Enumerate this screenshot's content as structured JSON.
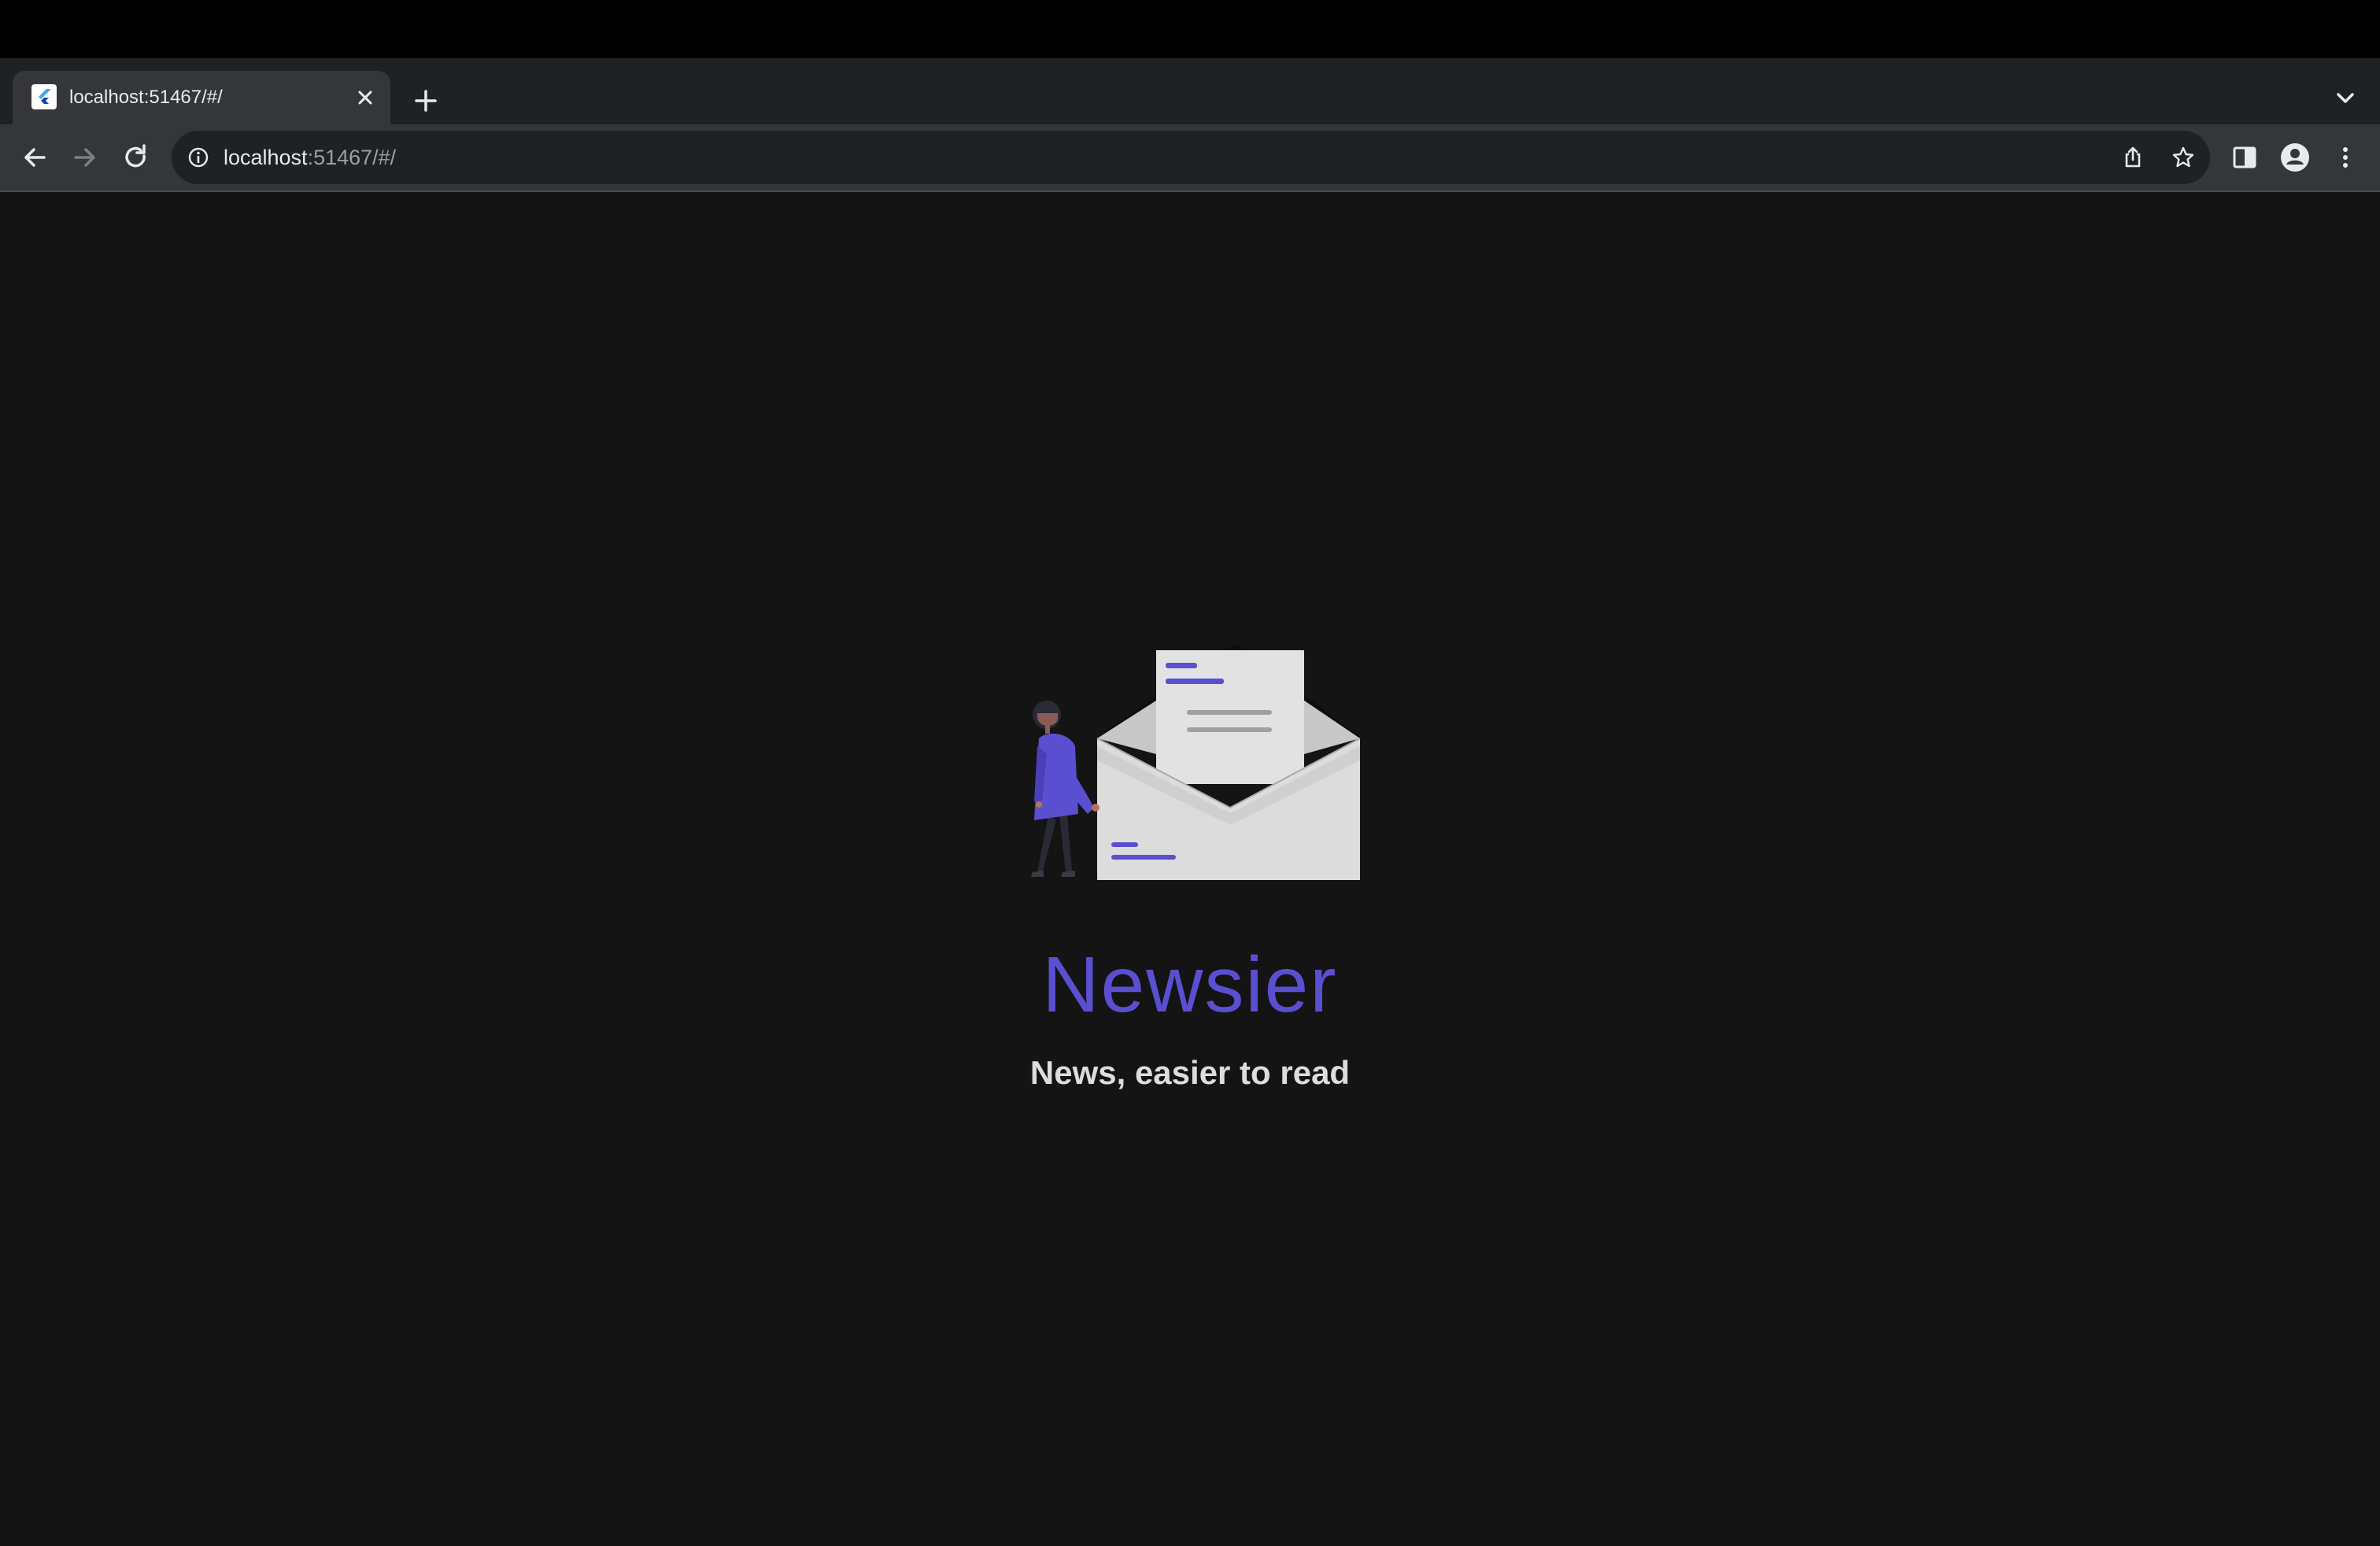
{
  "browser": {
    "tab": {
      "title": "localhost:51467/#/",
      "favicon": "flutter-icon"
    },
    "address_bar": {
      "host": "localhost",
      "path": ":51467/#/"
    },
    "icons": {
      "back": "arrow-left-icon",
      "forward": "arrow-right-icon",
      "reload": "reload-icon",
      "site_info": "info-icon",
      "share": "share-icon",
      "bookmark": "star-icon",
      "side_panel": "side-panel-icon",
      "profile": "profile-icon",
      "menu": "kebab-menu-icon",
      "new_tab": "plus-icon",
      "tab_list": "chevron-down-icon",
      "tab_close": "close-icon"
    }
  },
  "app": {
    "title": "Newsier",
    "subtitle": "News, easier to read",
    "illustration": "person-with-open-envelope-illustration"
  },
  "colors": {
    "background": "#141414",
    "accent": "#5b4fd1",
    "subtitle": "#dddddd",
    "tab_strip": "#202124",
    "toolbar": "#35363a"
  }
}
